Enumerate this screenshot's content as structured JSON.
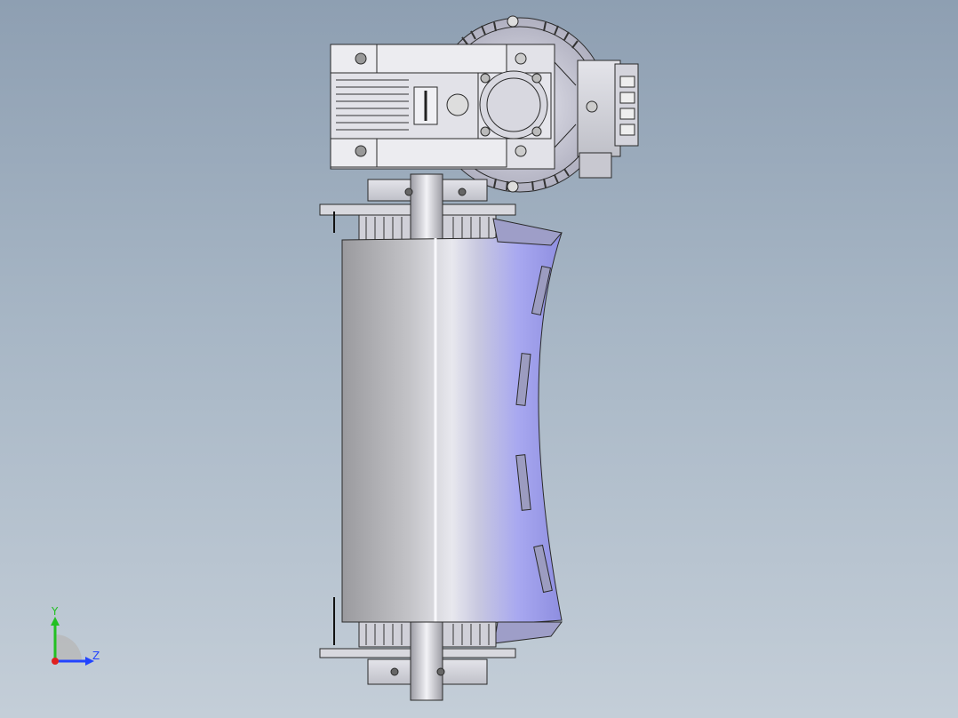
{
  "view": {
    "background_top": "#8e9fb2",
    "background_bottom": "#c4ced8",
    "part_color": "#d9d9dd",
    "drum_color": "#b9b9c4",
    "highlight_color": "#b8b8ff",
    "edge_color": "#2a2a2a"
  },
  "triad": {
    "y_label": "Y",
    "z_label": "Z",
    "y_color": "#22c022",
    "z_color": "#2244ff",
    "x_color": "#e02020"
  }
}
